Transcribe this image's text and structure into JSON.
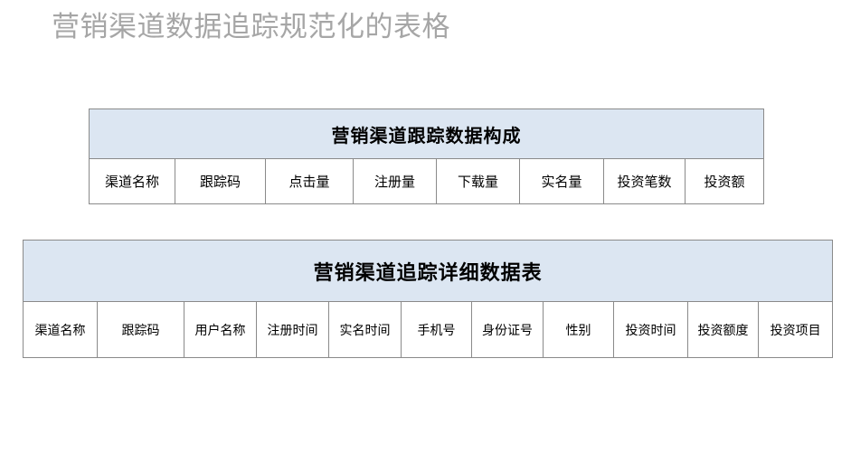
{
  "slide": {
    "title": "营销渠道数据追踪规范化的表格",
    "title_color": "#a6a6a6",
    "background_color": "#ffffff"
  },
  "tables": [
    {
      "id": "channel-composition",
      "caption": "营销渠道跟踪数据构成",
      "caption_fill": "#dce6f2",
      "border_color": "#8a8a8a",
      "columns": [
        "渠道名称",
        "跟踪码",
        "点击量",
        "注册量",
        "下载量",
        "实名量",
        "投资笔数",
        "投资额"
      ]
    },
    {
      "id": "channel-detail",
      "caption": "营销渠道追踪详细数据表",
      "caption_fill": "#dce6f2",
      "border_color": "#8a8a8a",
      "columns": [
        "渠道名称",
        "跟踪码",
        "用户名称",
        "注册时间",
        "实名时间",
        "手机号",
        "身份证号",
        "性别",
        "投资时间",
        "投资额度",
        "投资项目"
      ]
    }
  ]
}
